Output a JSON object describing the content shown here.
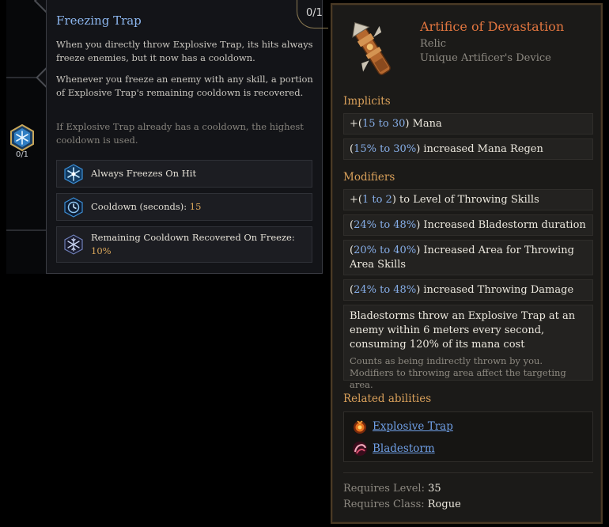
{
  "skill_node": {
    "count": "0/1",
    "icon": "snowflake-hex-icon"
  },
  "skill_tooltip": {
    "title": "Freezing Trap",
    "rank": "0/1",
    "descriptions": [
      "When you directly throw Explosive Trap, its hits always freeze enemies, but it now has a cooldown.",
      "Whenever you freeze an enemy with any skill, a portion of Explosive Trap's remaining cooldown is recovered.",
      "If Explosive Trap already has a cooldown, the highest cooldown is used."
    ],
    "effects": [
      {
        "label": "Always Freezes On Hit",
        "value": "",
        "icon": "freeze-burst-icon"
      },
      {
        "label": "Cooldown (seconds): ",
        "value": "15",
        "icon": "cooldown-clock-icon"
      },
      {
        "label": "Remaining Cooldown Recovered On Freeze: ",
        "value": "10%",
        "icon": "snowflake-recover-icon"
      }
    ]
  },
  "item_tooltip": {
    "name": "Artifice of Devastation",
    "slot": "Relic",
    "base_type": "Unique Artificer's Device",
    "name_color": "#e1753f",
    "implicits_heading": "Implicits",
    "implicits": [
      {
        "prefix": "+(",
        "range": "15 to 30",
        "suffix": ") Mana"
      },
      {
        "prefix": "(",
        "range": "15% to 30%",
        "suffix": ") increased Mana Regen"
      }
    ],
    "modifiers_heading": "Modifiers",
    "modifiers": [
      {
        "prefix": "+(",
        "range": "1 to 2",
        "suffix": ") to Level of Throwing Skills"
      },
      {
        "prefix": "(",
        "range": "24% to 48%",
        "suffix": ") Increased Bladestorm duration"
      },
      {
        "prefix": "(",
        "range": "20% to 40%",
        "suffix": ") Increased Area for Throwing Area Skills"
      },
      {
        "prefix": "(",
        "range": "24% to 48%",
        "suffix": ") increased Throwing Damage"
      }
    ],
    "unique_effect": "Bladestorms throw an Explosive Trap at an enemy within 6 meters every second, consuming 120% of its mana cost",
    "unique_note": "Counts as being indirectly thrown by you. Modifiers to throwing area affect the targeting area.",
    "related_heading": "Related abilities",
    "related": [
      {
        "label": "Explosive Trap",
        "icon": "explosive-trap-icon"
      },
      {
        "label": "Bladestorm",
        "icon": "bladestorm-icon"
      }
    ],
    "requirements": {
      "level_label": "Requires Level: ",
      "level": "35",
      "class_label": "Requires Class: ",
      "class": "Rogue"
    }
  }
}
